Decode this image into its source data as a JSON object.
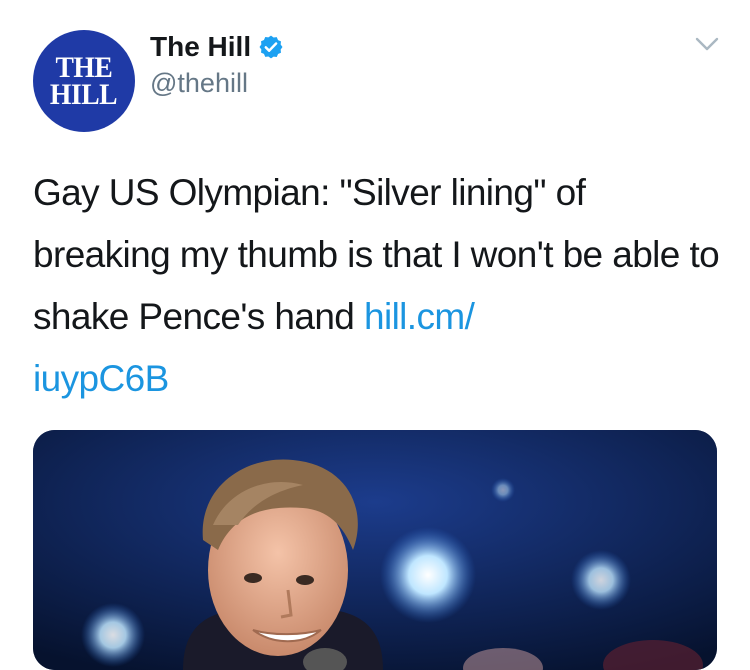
{
  "account": {
    "avatar_logo_line1": "THE",
    "avatar_logo_line2": "HILL",
    "display_name": "The Hill",
    "verified": true,
    "handle": "@thehill"
  },
  "tweet": {
    "text": "Gay US Olympian: \"Silver lining\" of breaking my thumb is that I won't be able to shake Pence's hand ",
    "link_line1": "hill.cm/",
    "link_line2": "iuypC6B"
  },
  "media": {
    "type": "photo",
    "description_hidden": true
  },
  "colors": {
    "brand_blue": "#1f3aa6",
    "verified_blue": "#1da1f2",
    "link_blue": "#1b95e0",
    "handle_gray": "#657786",
    "text": "#14171a"
  },
  "icons": {
    "verified": "verified-badge-icon",
    "more": "chevron-down-icon"
  }
}
